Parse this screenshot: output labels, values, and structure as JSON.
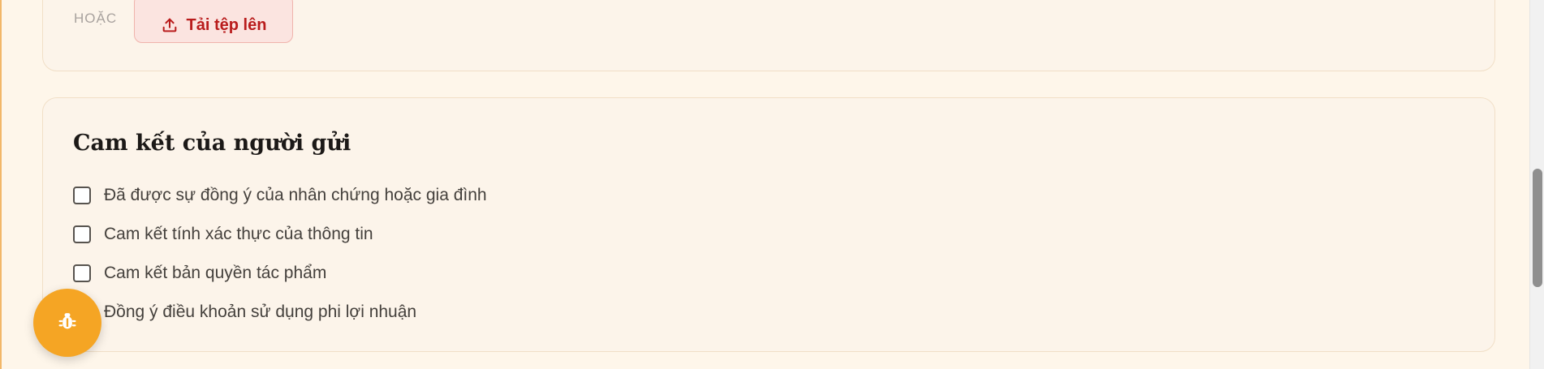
{
  "upload_section": {
    "or_label": "HOẶC",
    "upload_button_label": "Tải tệp lên",
    "upload_icon": "upload-icon"
  },
  "commitment_section": {
    "title": "Cam kết của người gửi",
    "items": [
      {
        "label": "Đã được sự đồng ý của nhân chứng hoặc gia đình",
        "checked": false
      },
      {
        "label": "Cam kết tính xác thực của thông tin",
        "checked": false
      },
      {
        "label": "Cam kết bản quyền tác phẩm",
        "checked": false
      },
      {
        "label": "Đồng ý điều khoản sử dụng phi lợi nhuận",
        "checked": false
      }
    ]
  },
  "debug_button": {
    "icon": "bug-icon",
    "color": "#f5a524"
  },
  "colors": {
    "accent_red": "#b91c1c",
    "page_background": "#fef6ea",
    "card_background": "#fcf4ea"
  }
}
